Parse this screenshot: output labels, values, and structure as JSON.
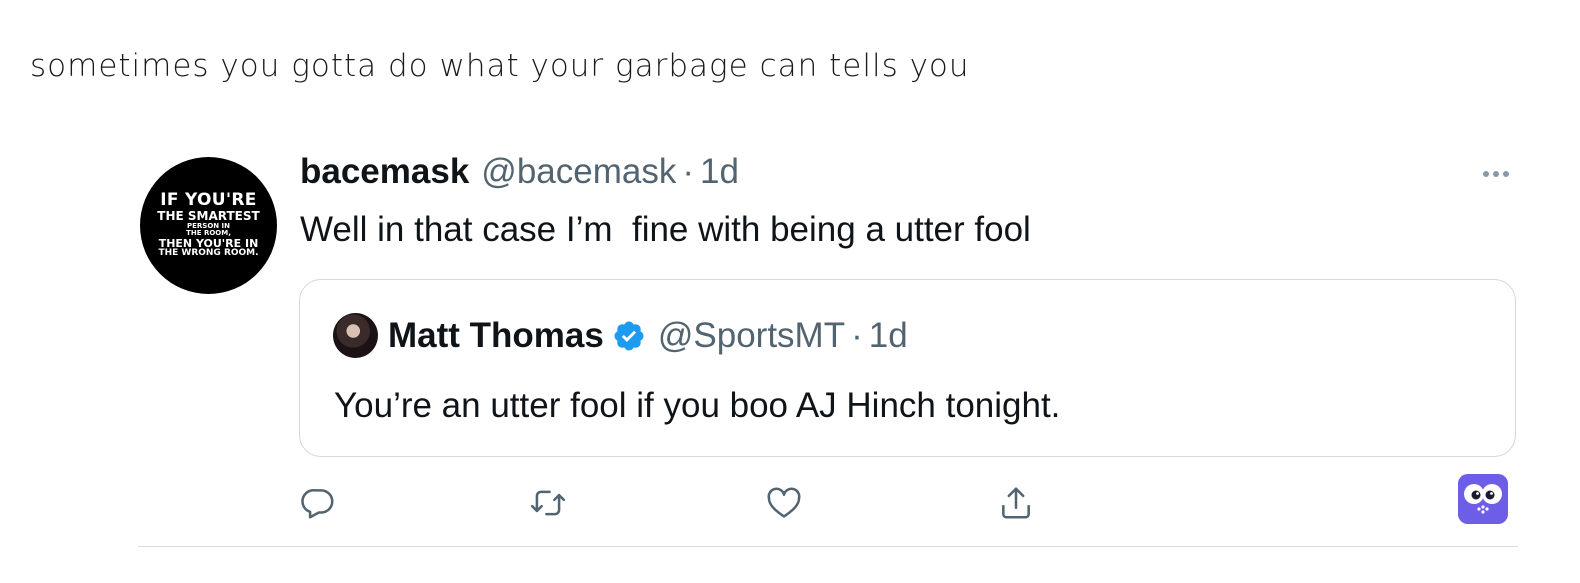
{
  "caption": "sometimes you gotta do what your garbage can tells you",
  "tweet": {
    "avatar_text": {
      "line1": "IF YOU'RE",
      "line2": "THE SMARTEST",
      "line3": "PERSON IN",
      "line4": "THE ROOM,",
      "line5": "THEN YOU'RE IN",
      "line6": "THE WRONG ROOM."
    },
    "name": "bacemask",
    "handle": "@bacemask",
    "separator": "·",
    "time": "1d",
    "text": "Well in that case I’m  fine with being a utter fool",
    "more_icon": "more-horizontal-icon"
  },
  "quoted_tweet": {
    "name": "Matt Thomas",
    "verified_icon": "verified-badge-icon",
    "handle": "@SportsMT",
    "separator": "·",
    "time": "1d",
    "text": "You’re an utter fool if you boo AJ Hinch tonight."
  },
  "actions": {
    "icons": [
      "reply-icon",
      "retweet-icon",
      "like-icon",
      "share-icon"
    ]
  },
  "watermark_icon": "owl-logo-icon",
  "colors": {
    "primary_text": "#0f1419",
    "secondary_text": "#536471",
    "verified_blue": "#1d9bf0",
    "border": "#cfd9de"
  }
}
